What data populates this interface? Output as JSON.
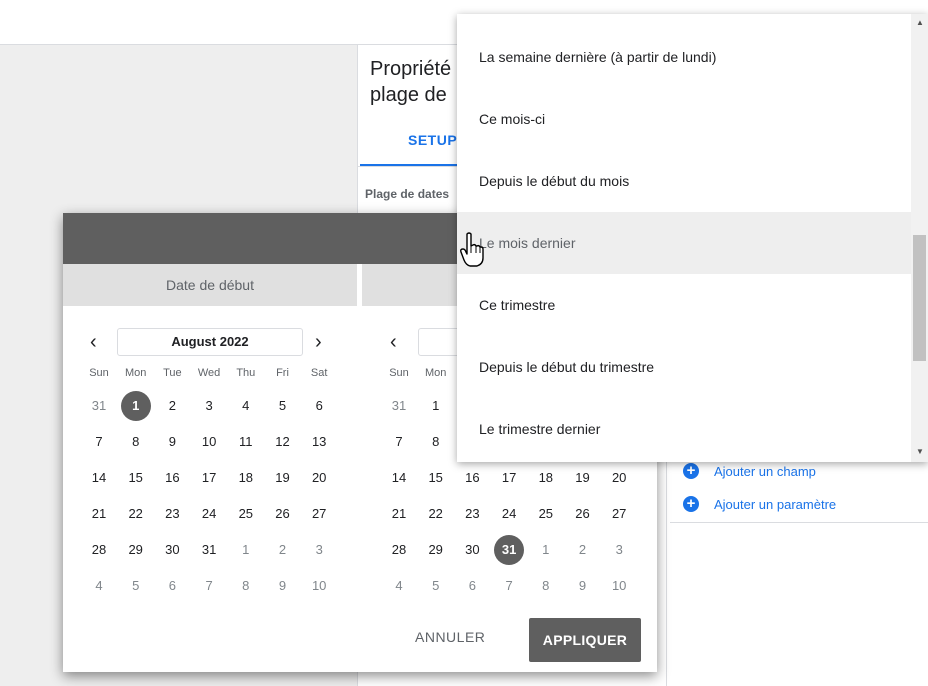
{
  "panel": {
    "title": "Propriété\nplage de",
    "tab_setup": "SETUP",
    "date_range_label": "Plage de dates",
    "add_field": "Ajouter un champ",
    "add_param": "Ajouter un paramètre"
  },
  "dialog": {
    "start_label": "Date de début",
    "end_label": "",
    "cancel_label": "ANNULER",
    "apply_label": "APPLIQUER",
    "start_month": "August 2022",
    "end_month": "",
    "weekdays": [
      "Sun",
      "Mon",
      "Tue",
      "Wed",
      "Thu",
      "Fri",
      "Sat"
    ],
    "end_weekdays": [
      "Sun",
      "Mon"
    ],
    "start_weeks": [
      [
        "31",
        "1",
        "2",
        "3",
        "4",
        "5",
        "6"
      ],
      [
        "7",
        "8",
        "9",
        "10",
        "11",
        "12",
        "13"
      ],
      [
        "14",
        "15",
        "16",
        "17",
        "18",
        "19",
        "20"
      ],
      [
        "21",
        "22",
        "23",
        "24",
        "25",
        "26",
        "27"
      ],
      [
        "28",
        "29",
        "30",
        "31",
        "1",
        "2",
        "3"
      ],
      [
        "4",
        "5",
        "6",
        "7",
        "8",
        "9",
        "10"
      ]
    ],
    "end_weeks": [
      [
        "31",
        "1",
        "",
        "",
        "",
        "",
        ""
      ],
      [
        "7",
        "8",
        "",
        "",
        "",
        "",
        ""
      ],
      [
        "14",
        "15",
        "16",
        "17",
        "18",
        "19",
        "20"
      ],
      [
        "21",
        "22",
        "23",
        "24",
        "25",
        "26",
        "27"
      ],
      [
        "28",
        "29",
        "30",
        "31",
        "1",
        "2",
        "3"
      ],
      [
        "4",
        "5",
        "6",
        "7",
        "8",
        "9",
        "10"
      ]
    ]
  },
  "dropdown": {
    "items": [
      "La semaine dernière (à partir de lundi)",
      "Ce mois-ci",
      "Depuis le début du mois",
      "Le mois dernier",
      "Ce trimestre",
      "Depuis le début du trimestre",
      "Le trimestre dernier"
    ],
    "hovered_index": 3
  },
  "colors": {
    "accent": "#1a73e8",
    "header": "#5f5f5f"
  }
}
